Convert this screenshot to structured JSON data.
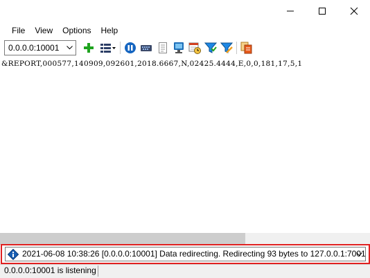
{
  "window": {
    "controls": {
      "minimize": "minimize-icon",
      "maximize": "maximize-icon",
      "close": "close-icon"
    }
  },
  "menu": {
    "items": [
      {
        "label": "File"
      },
      {
        "label": "View"
      },
      {
        "label": "Options"
      },
      {
        "label": "Help"
      }
    ]
  },
  "toolbar": {
    "address_value": "0.0.0.0:10001",
    "icons": [
      "add-icon",
      "columns-icon",
      "pause-icon",
      "serial-port-icon",
      "document-icon",
      "monitor-icon",
      "schedule-icon",
      "filter-icon",
      "filter-edit-icon",
      "copy-icon"
    ],
    "colors": {
      "add": "#1fa31f",
      "pause": "#1565c0",
      "filter": "#1e88e5"
    }
  },
  "content": {
    "line": "&REPORT,000577,140909,092601,2018.6667,N,02425.4444,E,0,0,181,17,5,1"
  },
  "log": {
    "entry": "2021-06-08 10:38:26 [0.0.0.0:10001] Data redirecting. Redirecting 93 bytes to 127.0.0.1:7001",
    "highlight_color": "#e02020"
  },
  "status": {
    "text": "0.0.0.0:10001 is listening"
  }
}
